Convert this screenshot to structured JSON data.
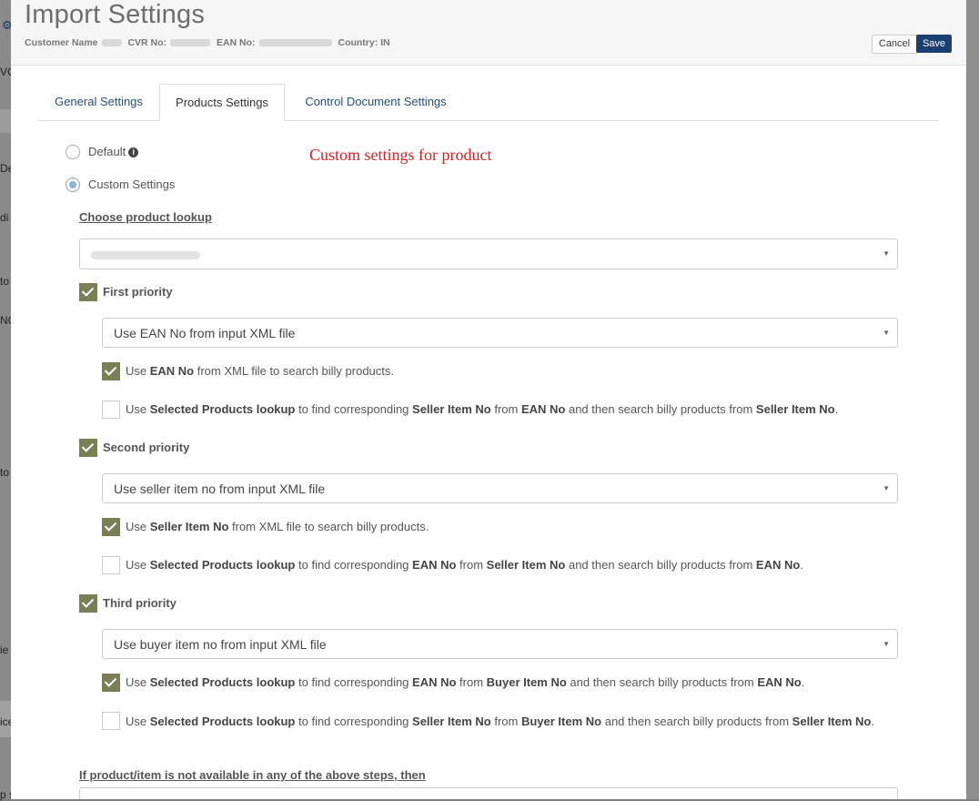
{
  "background": {
    "fragments": [
      "VC",
      "De",
      "di",
      "to",
      "NC",
      "to",
      "ie",
      "ice",
      "p s"
    ]
  },
  "header": {
    "title": "Import Settings",
    "customer_label": "Customer Name",
    "cvr_label": "CVR No:",
    "ean_label": "EAN No:",
    "country_label": "Country: IN",
    "cancel_label": "Cancel",
    "save_label": "Save"
  },
  "tabs": [
    {
      "label": "General Settings"
    },
    {
      "label": "Products Settings"
    },
    {
      "label": "Control Document Settings"
    }
  ],
  "options": {
    "default_label": "Default",
    "custom_label": "Custom Settings",
    "note": "Custom settings for product"
  },
  "lookup": {
    "title": "Choose product lookup"
  },
  "priorities": [
    {
      "label": "First priority",
      "checked": true,
      "select": "Use EAN No from input XML file",
      "options": [
        {
          "checked": true,
          "parts": [
            "Use ",
            "EAN No",
            " from XML file to search billy products."
          ]
        },
        {
          "checked": false,
          "parts": [
            "Use ",
            "Selected Products lookup",
            " to find corresponding ",
            "Seller Item No",
            " from ",
            "EAN No",
            " and then search billy products from ",
            "Seller Item No",
            "."
          ]
        }
      ]
    },
    {
      "label": "Second priority",
      "checked": true,
      "select": "Use seller item no from input XML file",
      "options": [
        {
          "checked": true,
          "parts": [
            "Use ",
            "Seller Item No",
            " from XML file to search billy products."
          ]
        },
        {
          "checked": false,
          "parts": [
            "Use ",
            "Selected Products lookup",
            " to find corresponding ",
            "EAN No",
            " from ",
            "Seller Item No",
            " and then search billy products from ",
            "EAN No",
            "."
          ]
        }
      ]
    },
    {
      "label": "Third priority",
      "checked": true,
      "select": "Use buyer item no from input XML file",
      "options": [
        {
          "checked": true,
          "parts": [
            "Use ",
            "Selected Products lookup",
            " to find corresponding ",
            "EAN No",
            " from ",
            "Buyer Item No",
            " and then search billy products from ",
            "EAN No",
            "."
          ]
        },
        {
          "checked": false,
          "parts": [
            "Use ",
            "Selected Products lookup",
            " to find corresponding ",
            "Seller Item No",
            " from ",
            "Buyer Item No",
            " and then search billy products from ",
            "Seller Item No",
            "."
          ]
        }
      ]
    }
  ],
  "fallback": {
    "title": "If product/item is not available in any of the above steps, then"
  },
  "colors": {
    "save": "#1b3f6e",
    "check": "#7b7f55",
    "note": "#e01b1b"
  }
}
